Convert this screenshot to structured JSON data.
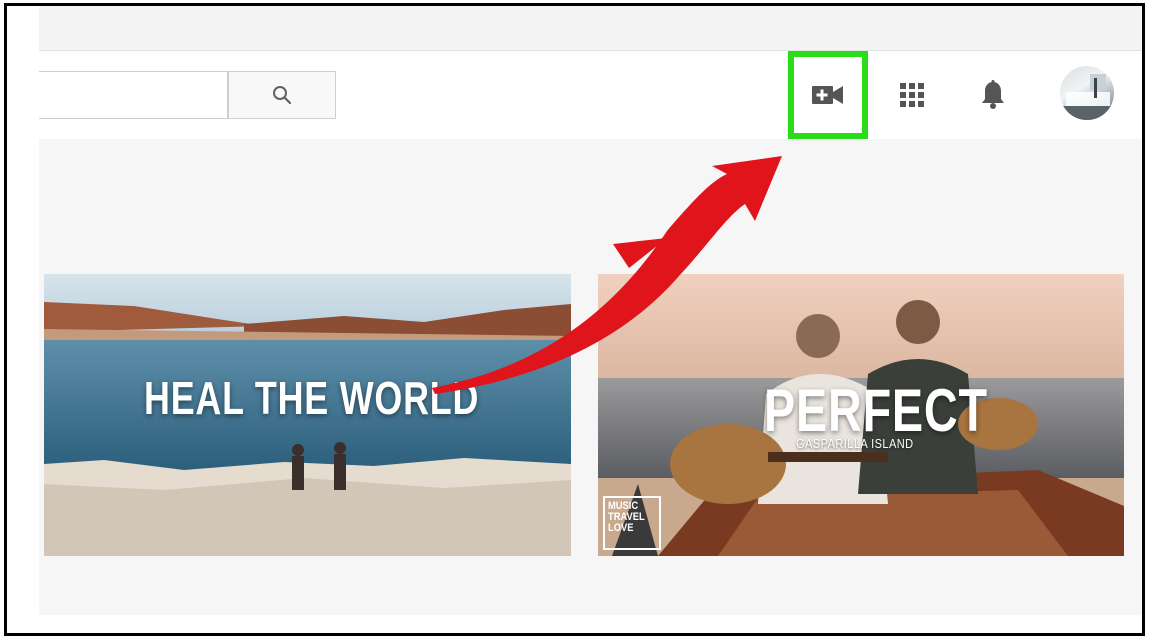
{
  "header": {
    "search": {
      "value": "",
      "placeholder": ""
    },
    "buttons": [
      {
        "name": "create-video",
        "icon": "video-camera-plus-icon"
      },
      {
        "name": "apps",
        "icon": "apps-grid-icon"
      },
      {
        "name": "notifications",
        "icon": "bell-icon"
      }
    ],
    "highlight_color": "#2bdc18"
  },
  "videos": [
    {
      "title": "HEAL THE WORLD"
    },
    {
      "title": "PERFECT",
      "subtitle": "GASPARILLA ISLAND",
      "logo_lines": [
        "MUSIC",
        "TRAVEL",
        "LOVE"
      ]
    }
  ],
  "annotation": {
    "arrow_color": "#e0141b"
  }
}
